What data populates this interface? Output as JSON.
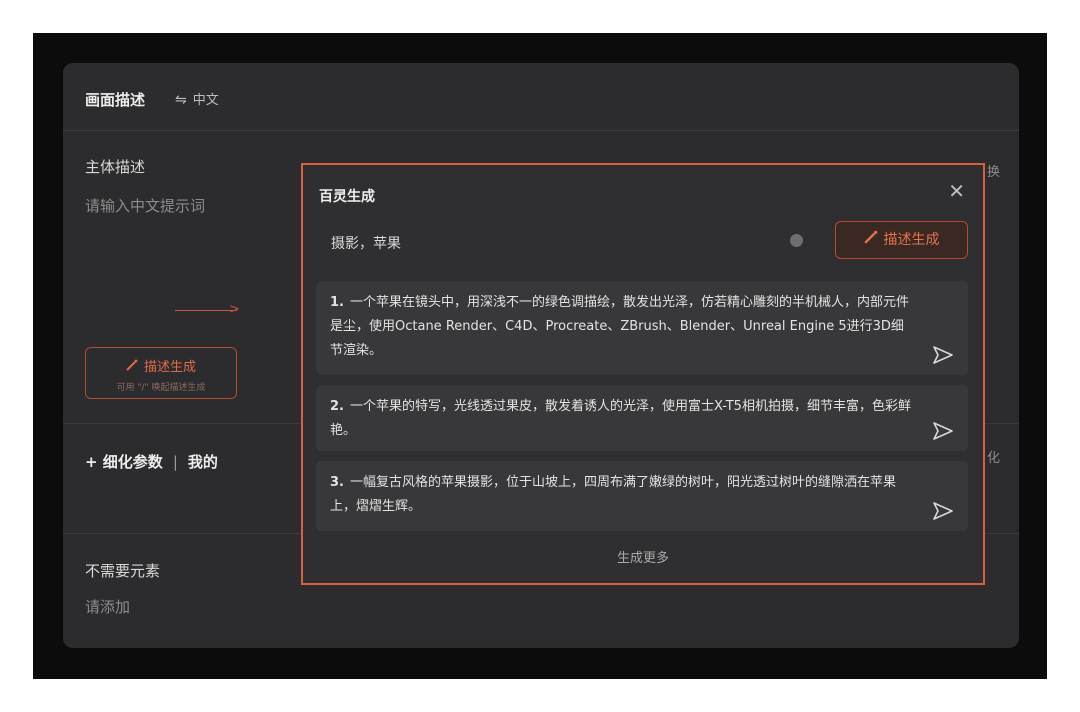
{
  "header": {
    "title": "画面描述",
    "lang_toggle": "中文"
  },
  "subject": {
    "label": "主体描述",
    "placeholder": "请输入中文提示词"
  },
  "generate_left": {
    "label": "描述生成",
    "hint": "可用 \"/\" 唤起描述生成"
  },
  "refine": {
    "tab1": "细化参数",
    "separator": "|",
    "tab2": "我的"
  },
  "negative": {
    "label": "不需要元素",
    "placeholder": "请添加"
  },
  "right_stubs": {
    "top": "换",
    "middle": "化"
  },
  "popup": {
    "title": "百灵生成",
    "input_value": "摄影，苹果",
    "generate_label": "描述生成",
    "results": [
      {
        "num": "1.",
        "text": "一个苹果在镜头中，用深浅不一的绿色调描绘，散发出光泽，仿若精心雕刻的半机械人，内部元件是尘，使用Octane Render、C4D、Procreate、ZBrush、Blender、Unreal Engine 5进行3D细节渲染。"
      },
      {
        "num": "2.",
        "text": "一个苹果的特写，光线透过果皮，散发着诱人的光泽，使用富士X-T5相机拍摄，细节丰富，色彩鲜艳。"
      },
      {
        "num": "3.",
        "text": "一幅复古风格的苹果摄影，位于山坡上，四周布满了嫩绿的树叶，阳光透过树叶的缝隙洒在苹果上，熠熠生辉。"
      }
    ],
    "more_label": "生成更多"
  },
  "colors": {
    "accent": "#d5613f",
    "panel_bg": "#2c2c2e",
    "popup_bg": "#2f2f31"
  },
  "icons": {
    "swap": "swap-arrows-icon",
    "wand": "magic-wand-icon",
    "close": "close-icon",
    "send": "send-icon",
    "clear": "clear-icon"
  }
}
